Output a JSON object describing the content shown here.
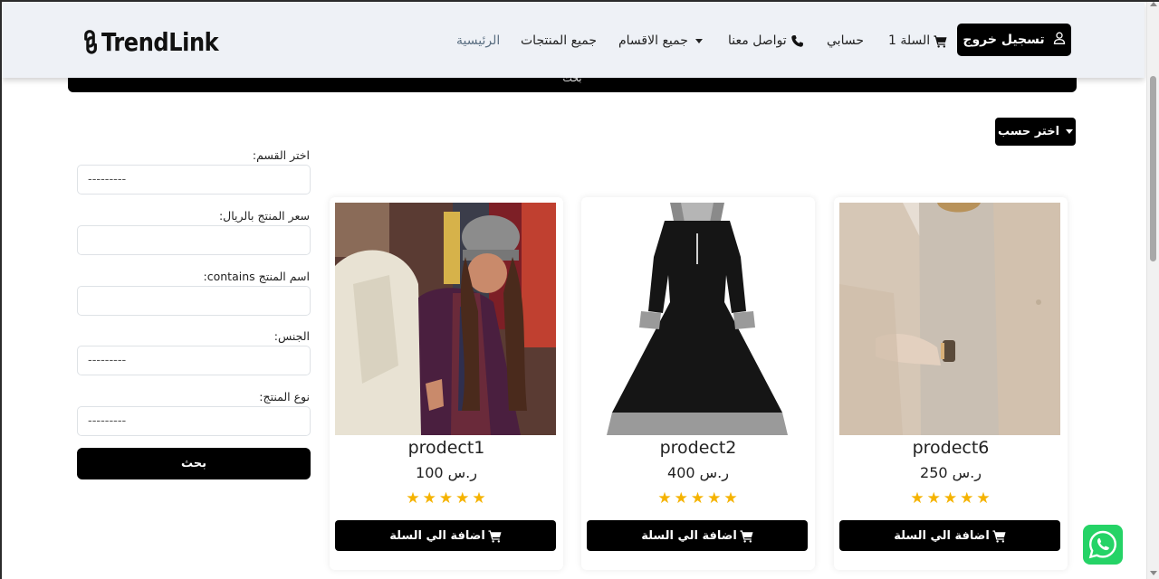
{
  "brand": {
    "name": "TrendLink"
  },
  "nav": {
    "logout_label": "تسجيل خروج",
    "cart_label": "السلة 1",
    "account_label": "حسابي",
    "contact_label": "تواصل معنا",
    "categories_label": "جميع الاقسام",
    "all_products_label": "جميع المنتجات",
    "home_label": "الرئيسية"
  },
  "top_search": {
    "label": "بحث"
  },
  "sort": {
    "label": "اختر حسب"
  },
  "filters": {
    "category": {
      "label": ":اختر القسم",
      "value": "---------"
    },
    "price": {
      "label": ":سعر المنتج بالريال",
      "value": ""
    },
    "name": {
      "label": ":contains اسم المنتج",
      "value": ""
    },
    "gender": {
      "label": ":الجنس",
      "value": "---------"
    },
    "product_type": {
      "label": ":نوع المنتج",
      "value": "---------"
    },
    "search_button": "بحث"
  },
  "products": [
    {
      "title": "prodect6",
      "price": "250 ر.س",
      "rating": 5,
      "add_label": "اضافة الي السلة"
    },
    {
      "title": "prodect2",
      "price": "400 ر.س",
      "rating": 5,
      "add_label": "اضافة الي السلة"
    },
    {
      "title": "prodect1",
      "price": "100 ر.س",
      "rating": 5,
      "add_label": "اضافة الي السلة"
    }
  ],
  "colors": {
    "primary": "#000000",
    "navbar_bg": "#eef1f6",
    "star": "#f5b301",
    "whatsapp": "#25d366",
    "home_link": "#5b6f82"
  },
  "icons": [
    "user-icon",
    "cart-icon",
    "phone-icon",
    "whatsapp-icon",
    "chain-link-icon"
  ]
}
